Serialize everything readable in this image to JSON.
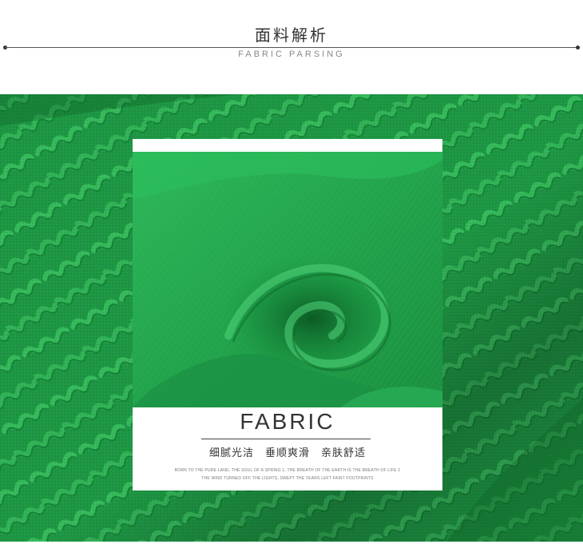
{
  "header": {
    "title_cn": "面料解析",
    "title_en": "FABRIC PARSING"
  },
  "card": {
    "title": "FABRIC",
    "subtitle": "细腻光洁　垂顺爽滑　亲肤舒适",
    "fine_line_1": "BORN TO THE PURE LAND, THE SOUL OF A SPRING 1, THE BREATH OF THE EARTH IS THE BREATH OF LIFE 2",
    "fine_line_2": "THE WIND TURNED OFF THE LIGHTS, SWEPT THE YEARS LEFT FAINT FOOTPRINTS"
  },
  "colors": {
    "fabric_green": "#1f9a45",
    "fabric_green_dark": "#137a33",
    "fabric_green_light": "#34b85a",
    "card_background": "#ffffff",
    "text_dark": "#333333"
  },
  "images": {
    "background": "green-jacquard-fabric-texture",
    "card_photo": "green-satin-fabric-swirl"
  }
}
